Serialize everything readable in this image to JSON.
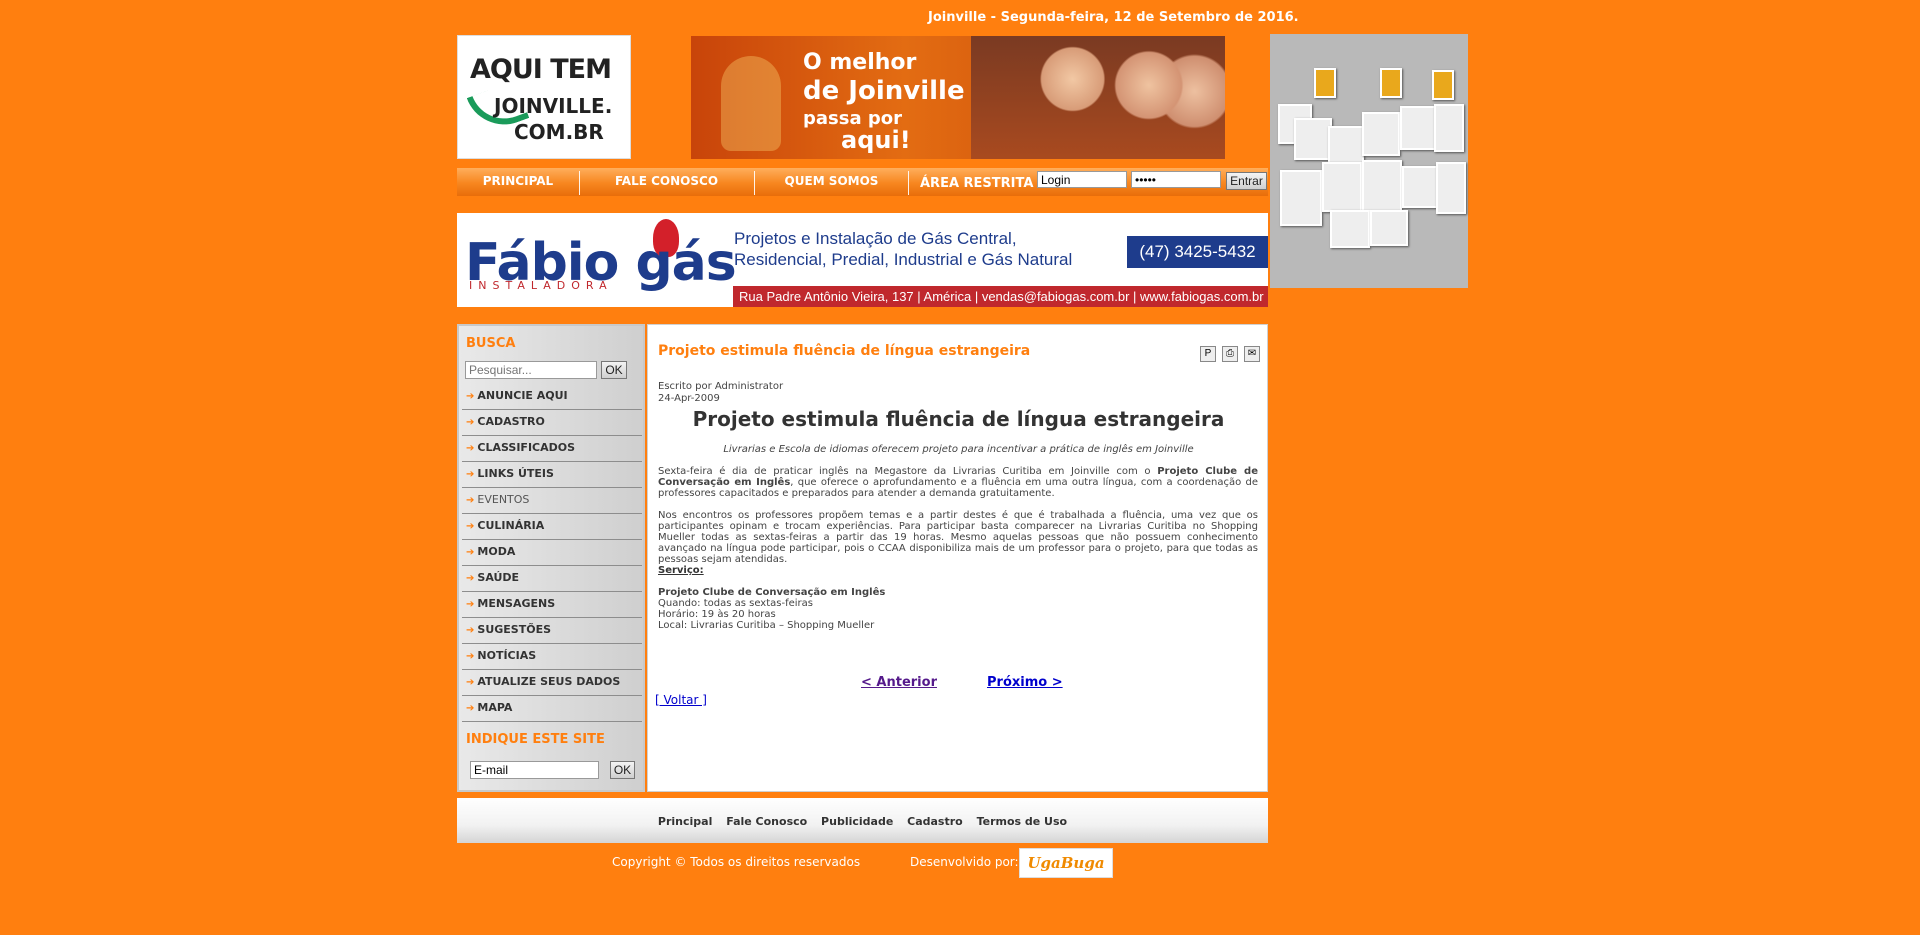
{
  "header": {
    "date": "Joinville - Segunda-feira, 12 de Setembro de 2016."
  },
  "logo": {
    "line1": "AQUI TEM",
    "line2": "JOINVILLE.",
    "line3": "COM.BR"
  },
  "banner": {
    "line1": "O melhor",
    "line2": "de Joinville",
    "line3": "passa por",
    "line4": "aqui!"
  },
  "nav": {
    "items": [
      {
        "label": "PRINCIPAL"
      },
      {
        "label": "FALE CONOSCO"
      },
      {
        "label": "QUEM SOMOS"
      }
    ],
    "restricted_label": "ÁREA RESTRITA",
    "login_value": "Login",
    "password_value": "•••••",
    "submit_label": "Entrar"
  },
  "ad": {
    "brand_part1": "Fábio g",
    "brand_part2": "ás",
    "tagline": "INSTALADORA",
    "desc_line1": "Projetos e Instalação de Gás Central,",
    "desc_line2": "Residencial, Predial, Industrial e Gás Natural",
    "phone": "(47) 3425-5432",
    "address": "Rua Padre Antônio Vieira, 137 | América | vendas@fabiogas.com.br | www.fabiogas.com.br"
  },
  "sidebar": {
    "search_heading": "BUSCA",
    "search_placeholder": "Pesquisar...",
    "search_button": "OK",
    "menu": [
      {
        "label": "ANUNCIE AQUI"
      },
      {
        "label": "CADASTRO"
      },
      {
        "label": "CLASSIFICADOS"
      },
      {
        "label": "LINKS ÚTEIS"
      },
      {
        "label": "EVENTOS"
      },
      {
        "label": "CULINÁRIA"
      },
      {
        "label": "MODA"
      },
      {
        "label": "SAÚDE"
      },
      {
        "label": "MENSAGENS"
      },
      {
        "label": "SUGESTÕES"
      },
      {
        "label": "NOTÍCIAS"
      },
      {
        "label": "ATUALIZE SEUS DADOS"
      },
      {
        "label": "MAPA"
      }
    ],
    "indicate_heading": "INDIQUE ESTE SITE",
    "email_value": "E-mail",
    "email_button": "OK"
  },
  "article": {
    "title": "Projeto estimula fluência de língua estrangeira",
    "author": "Escrito por Administrator",
    "date": "24-Apr-2009",
    "heading": "Projeto estimula fluência de língua estrangeira",
    "lead": "Livrarias e Escola de idiomas oferecem projeto para incentivar a prática de inglês em Joinville",
    "p1_start": "Sexta-feira é dia de praticar inglês na Megastore da Livrarias Curitiba em Joinville com o ",
    "p1_bold": "Projeto Clube de Conversação em Inglês",
    "p1_end": ", que oferece o aprofundamento e a fluência em uma outra língua, com a coordenação de professores capacitados e preparados para atender a demanda gratuitamente.",
    "p2": "Nos encontros os professores propõem temas e a partir destes é que é trabalhada a fluência, uma vez que os participantes opinam e trocam experiências. Para participar basta comparecer na Livrarias Curitiba no Shopping Mueller todas as sextas-feiras a partir das 19 horas. Mesmo aquelas pessoas que não possuem conhecimento avançado na língua pode participar, pois o CCAA disponibiliza mais de um professor para o projeto, para que todas as pessoas sejam atendidas.",
    "service_heading": "Serviço:",
    "service_title": "Projeto Clube de Conversação em Inglês",
    "service_when": "Quando: todas as sextas-feiras",
    "service_hours": "Horário: 19 às 20 horas",
    "service_place": "Local: Livrarias Curitiba – Shopping Mueller",
    "prev_label": "< Anterior",
    "next_label": "Próximo >",
    "back_label": "[ Voltar ]"
  },
  "footer": {
    "links": [
      {
        "label": "Principal"
      },
      {
        "label": "Fale Conosco"
      },
      {
        "label": "Publicidade"
      },
      {
        "label": "Cadastro"
      },
      {
        "label": "Termos de Uso"
      }
    ],
    "copyright": "Copyright © Todos os direitos reservados",
    "developed_by": "Desenvolvido por:",
    "dev_logo": "UgaBuga"
  },
  "colors": {
    "background": "#ff7f0f",
    "accent": "#ff7f0f",
    "gas_blue": "#1e3c8c",
    "gas_red": "#c0282d",
    "link_visited": "#551a8b",
    "link": "#0000cc"
  }
}
